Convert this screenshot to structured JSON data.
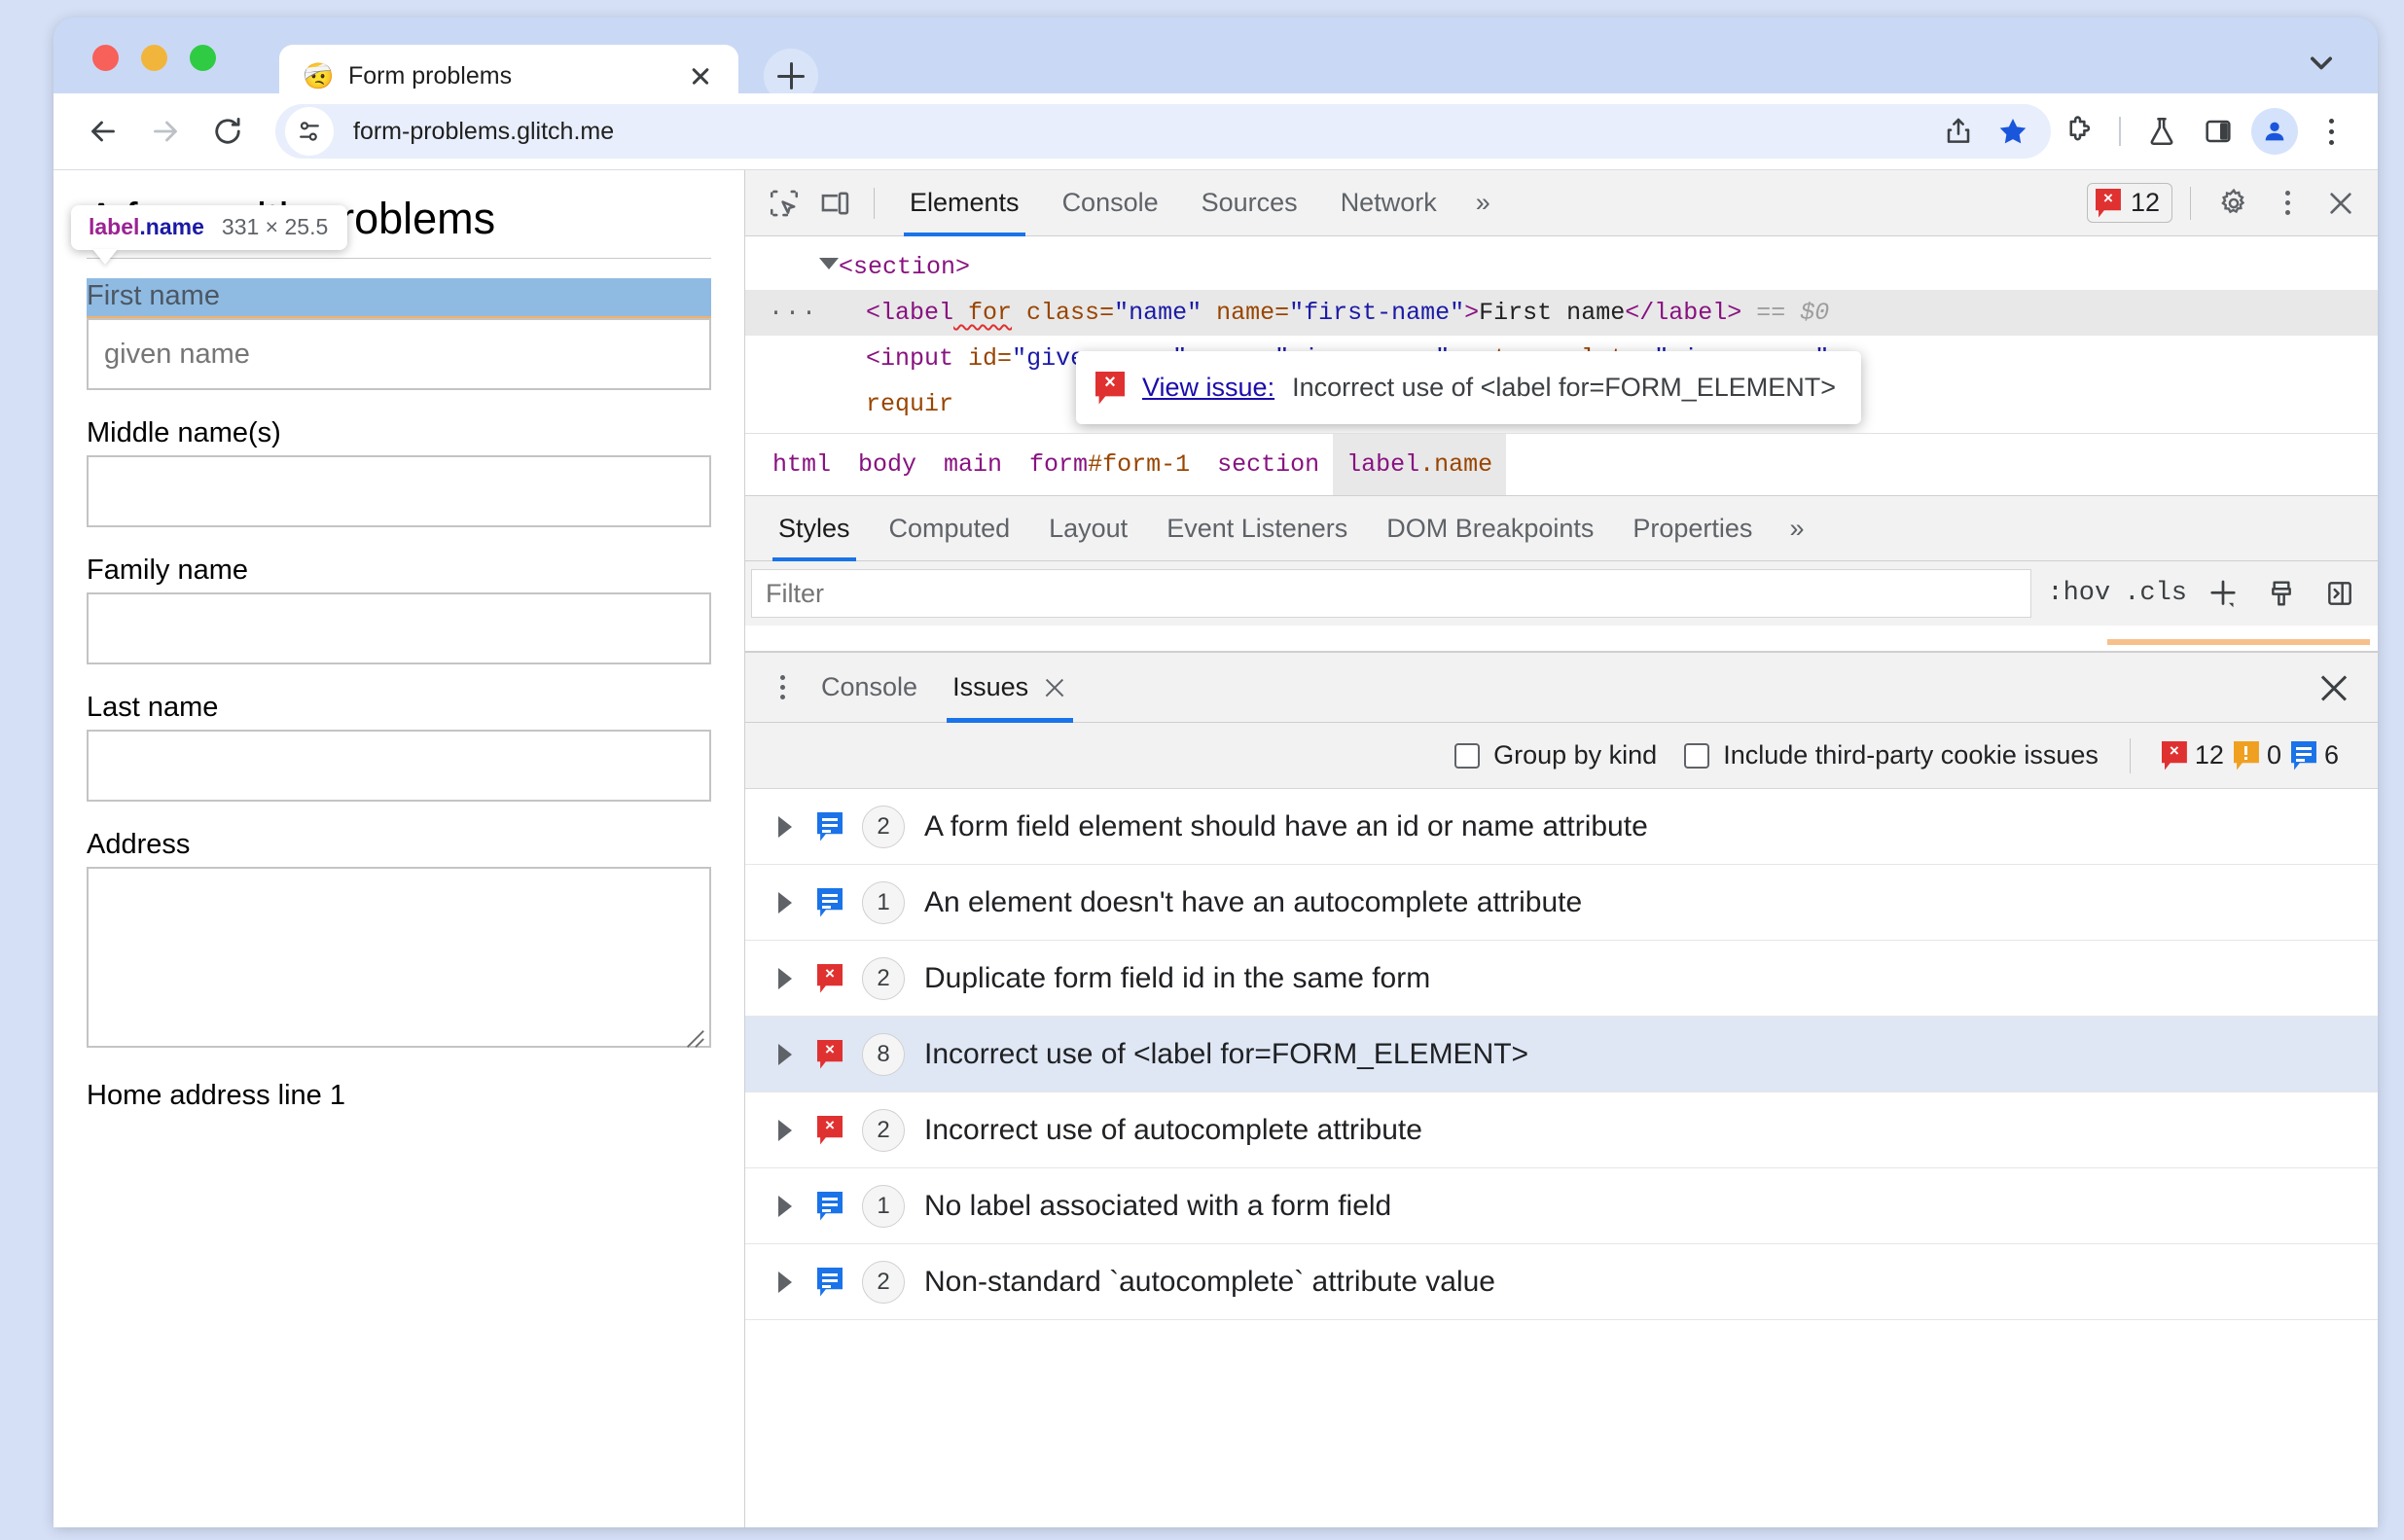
{
  "browser": {
    "tab": {
      "title": "Form problems",
      "favicon": "🤕"
    },
    "new_tab_label": "+",
    "omnibox": {
      "url": "form-problems.glitch.me"
    },
    "icons": {
      "back": "back-arrow-icon",
      "forward": "forward-arrow-icon",
      "reload": "reload-icon",
      "site_info": "site-settings-icon",
      "share": "share-icon",
      "bookmark": "star-filled-icon",
      "extensions": "puzzle-icon",
      "experiments": "flask-icon",
      "side_panel": "side-panel-icon",
      "profile": "avatar-icon",
      "menu": "three-dot-menu-icon",
      "tabstrip_chevron": "chevron-down-icon"
    }
  },
  "page": {
    "heading": "A form with problems",
    "fields": [
      {
        "label": "First name",
        "placeholder": "given name",
        "type": "input",
        "highlighted": true
      },
      {
        "label": "Middle name(s)",
        "placeholder": "",
        "type": "input",
        "highlighted": false
      },
      {
        "label": "Family name",
        "placeholder": "",
        "type": "input",
        "highlighted": false
      },
      {
        "label": "Last name",
        "placeholder": "",
        "type": "input",
        "highlighted": false
      },
      {
        "label": "Address",
        "placeholder": "",
        "type": "textarea",
        "highlighted": false
      },
      {
        "label": "Home address line 1",
        "placeholder": "",
        "type": "input",
        "highlighted": false
      }
    ],
    "element_tooltip": {
      "tag": "label",
      "class": ".name",
      "size": "331 × 25.5"
    }
  },
  "devtools": {
    "toolbar": {
      "inspect_icon": "inspect-element-icon",
      "device_icon": "device-toolbar-icon",
      "tabs": [
        {
          "label": "Elements",
          "active": true
        },
        {
          "label": "Console",
          "active": false
        },
        {
          "label": "Sources",
          "active": false
        },
        {
          "label": "Network",
          "active": false
        }
      ],
      "more_tabs": "»",
      "error_badge_count": "12",
      "settings_icon": "gear-icon",
      "menu_icon": "three-dot-menu-icon",
      "close_icon": "close-icon"
    },
    "dom_tree": {
      "lines": [
        {
          "indent": 1,
          "caret": true,
          "selected": false,
          "tokens": [
            {
              "t": "punct",
              "v": "<"
            },
            {
              "t": "tag",
              "v": "section"
            },
            {
              "t": "punct",
              "v": ">"
            }
          ]
        },
        {
          "indent": 2,
          "caret": false,
          "selected": true,
          "ellipsis": "···",
          "tokens": [
            {
              "t": "punct",
              "v": "<"
            },
            {
              "t": "tag",
              "v": "label"
            },
            {
              "t": "attr-error",
              "v": " for"
            },
            {
              "t": "attr",
              "v": " class"
            },
            {
              "t": "punct2",
              "v": "="
            },
            {
              "t": "val",
              "v": "\"name\""
            },
            {
              "t": "attr",
              "v": " name"
            },
            {
              "t": "punct2",
              "v": "="
            },
            {
              "t": "val",
              "v": "\"first-name\""
            },
            {
              "t": "punct",
              "v": ">"
            },
            {
              "t": "text",
              "v": "First name"
            },
            {
              "t": "punct",
              "v": "</"
            },
            {
              "t": "tag",
              "v": "label"
            },
            {
              "t": "punct",
              "v": ">"
            },
            {
              "t": "dim",
              "v": " == $0"
            }
          ]
        },
        {
          "indent": 2,
          "caret": false,
          "selected": false,
          "tokens": [
            {
              "t": "punct",
              "v": "<"
            },
            {
              "t": "tag",
              "v": "input"
            },
            {
              "t": "attr",
              "v": " id"
            },
            {
              "t": "punct2",
              "v": "="
            },
            {
              "t": "val",
              "v": "\"given-name\""
            },
            {
              "t": "attr",
              "v": " name"
            },
            {
              "t": "punct2",
              "v": "="
            },
            {
              "t": "val",
              "v": "\"given-name\""
            },
            {
              "t": "attr",
              "v": " autocomplete"
            },
            {
              "t": "punct2",
              "v": "="
            },
            {
              "t": "val",
              "v": "\"given-name\""
            }
          ]
        },
        {
          "indent": 2,
          "caret": false,
          "selected": false,
          "tokens": [
            {
              "t": "attr",
              "v": "requir"
            }
          ]
        }
      ],
      "issue_popover": {
        "link": "View issue:",
        "text": "Incorrect use of <label for=FORM_ELEMENT>"
      }
    },
    "breadcrumb": [
      {
        "label": "html",
        "suffix": "",
        "selected": false
      },
      {
        "label": "body",
        "suffix": "",
        "selected": false
      },
      {
        "label": "main",
        "suffix": "",
        "selected": false
      },
      {
        "label": "form",
        "suffix": "#form-1",
        "selected": false
      },
      {
        "label": "section",
        "suffix": "",
        "selected": false
      },
      {
        "label": "label",
        "suffix": ".name",
        "selected": true
      }
    ],
    "styles_tabs": [
      {
        "label": "Styles",
        "active": true
      },
      {
        "label": "Computed",
        "active": false
      },
      {
        "label": "Layout",
        "active": false
      },
      {
        "label": "Event Listeners",
        "active": false
      },
      {
        "label": "DOM Breakpoints",
        "active": false
      },
      {
        "label": "Properties",
        "active": false
      }
    ],
    "styles_more": "»",
    "styles_filter": {
      "placeholder": "Filter",
      "value": "",
      "hov_label": ":hov",
      "cls_label": ".cls",
      "new_style_rule_icon": "plus-icon",
      "computed_style_icon": "paintbrush-icon",
      "sidebar_toggle_icon": "panel-toggle-icon"
    },
    "drawer": {
      "kebab_icon": "three-dot-menu-icon",
      "tabs": [
        {
          "label": "Console",
          "active": false,
          "closable": false
        },
        {
          "label": "Issues",
          "active": true,
          "closable": true
        }
      ],
      "close_icon": "close-icon",
      "filters": {
        "group_by_kind": {
          "label": "Group by kind",
          "checked": false
        },
        "include_third_party": {
          "label": "Include third-party cookie issues",
          "checked": false
        },
        "counts": {
          "errors": "12",
          "warnings": "0",
          "info": "6"
        }
      },
      "issues": [
        {
          "severity": "info",
          "count": "2",
          "title": "A form field element should have an id or name attribute",
          "selected": false
        },
        {
          "severity": "info",
          "count": "1",
          "title": "An element doesn't have an autocomplete attribute",
          "selected": false
        },
        {
          "severity": "error",
          "count": "2",
          "title": "Duplicate form field id in the same form",
          "selected": false
        },
        {
          "severity": "error",
          "count": "8",
          "title": "Incorrect use of <label for=FORM_ELEMENT>",
          "selected": true
        },
        {
          "severity": "error",
          "count": "2",
          "title": "Incorrect use of autocomplete attribute",
          "selected": false
        },
        {
          "severity": "info",
          "count": "1",
          "title": "No label associated with a form field",
          "selected": false
        },
        {
          "severity": "info",
          "count": "2",
          "title": "Non-standard `autocomplete` attribute value",
          "selected": false
        }
      ]
    }
  },
  "colors": {
    "accent": "#1a73e8",
    "error": "#e03131",
    "warning": "#f0a020",
    "tab_strip": "#c9d9f5",
    "highlight_overlay": "#8fbbe3"
  }
}
